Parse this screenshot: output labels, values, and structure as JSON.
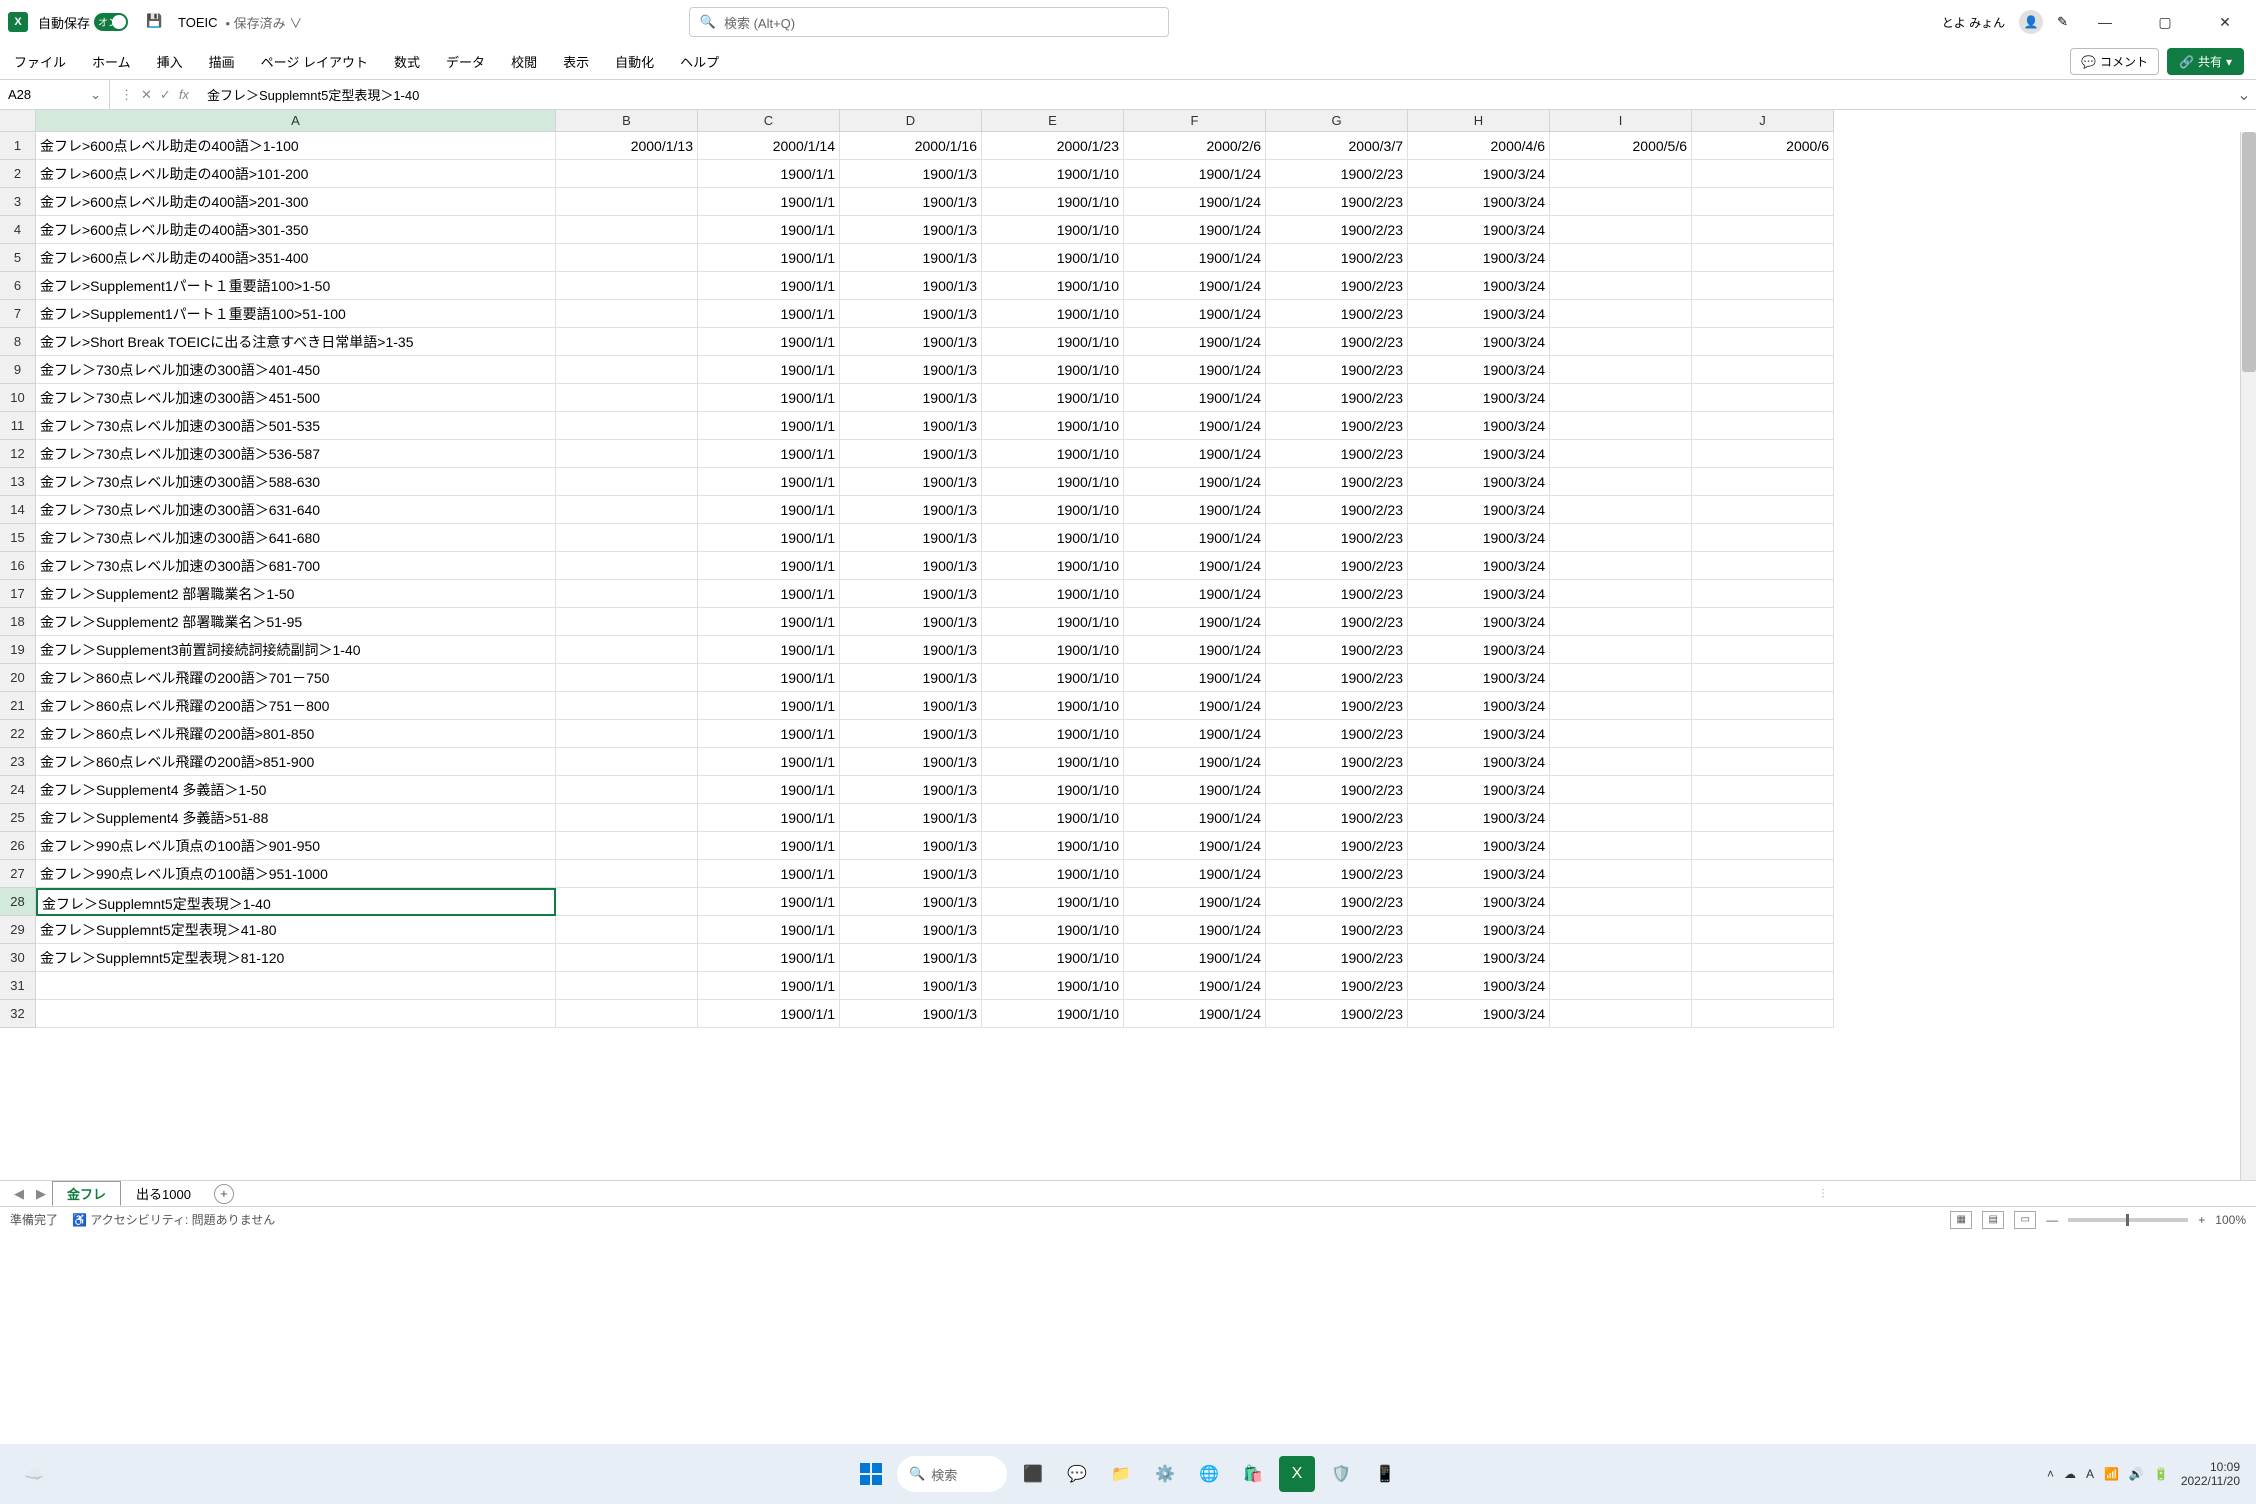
{
  "titlebar": {
    "autosave_label": "自動保存",
    "toggle_text": "オン",
    "doc_name": "TOEIC",
    "saved_status": "• 保存済み ∨",
    "search_placeholder": "検索 (Alt+Q)",
    "user_name": "とよ みょん"
  },
  "ribbon": {
    "tabs": [
      "ファイル",
      "ホーム",
      "挿入",
      "描画",
      "ページ レイアウト",
      "数式",
      "データ",
      "校閲",
      "表示",
      "自動化",
      "ヘルプ"
    ],
    "comment": "コメント",
    "share": "共有"
  },
  "formula": {
    "name_box": "A28",
    "value": "金フレ＞Supplemnt5定型表現＞1-40"
  },
  "columns": [
    "A",
    "B",
    "C",
    "D",
    "E",
    "F",
    "G",
    "H",
    "I",
    "J"
  ],
  "selected_row": 28,
  "rows": [
    {
      "n": 1,
      "A": "金フレ>600点レベル助走の400語＞1-100",
      "B": "2000/1/13",
      "C": "2000/1/14",
      "D": "2000/1/16",
      "E": "2000/1/23",
      "F": "2000/2/6",
      "G": "2000/3/7",
      "H": "2000/4/6",
      "I": "2000/5/6",
      "J": "2000/6"
    },
    {
      "n": 2,
      "A": "金フレ>600点レベル助走の400語>101-200",
      "B": "",
      "C": "1900/1/1",
      "D": "1900/1/3",
      "E": "1900/1/10",
      "F": "1900/1/24",
      "G": "1900/2/23",
      "H": "1900/3/24",
      "I": "",
      "J": ""
    },
    {
      "n": 3,
      "A": "金フレ>600点レベル助走の400語>201-300",
      "B": "",
      "C": "1900/1/1",
      "D": "1900/1/3",
      "E": "1900/1/10",
      "F": "1900/1/24",
      "G": "1900/2/23",
      "H": "1900/3/24",
      "I": "",
      "J": ""
    },
    {
      "n": 4,
      "A": "金フレ>600点レベル助走の400語>301-350",
      "B": "",
      "C": "1900/1/1",
      "D": "1900/1/3",
      "E": "1900/1/10",
      "F": "1900/1/24",
      "G": "1900/2/23",
      "H": "1900/3/24",
      "I": "",
      "J": ""
    },
    {
      "n": 5,
      "A": "金フレ>600点レベル助走の400語>351-400",
      "B": "",
      "C": "1900/1/1",
      "D": "1900/1/3",
      "E": "1900/1/10",
      "F": "1900/1/24",
      "G": "1900/2/23",
      "H": "1900/3/24",
      "I": "",
      "J": ""
    },
    {
      "n": 6,
      "A": "金フレ>Supplement1パート１重要語100>1-50",
      "B": "",
      "C": "1900/1/1",
      "D": "1900/1/3",
      "E": "1900/1/10",
      "F": "1900/1/24",
      "G": "1900/2/23",
      "H": "1900/3/24",
      "I": "",
      "J": ""
    },
    {
      "n": 7,
      "A": "金フレ>Supplement1パート１重要語100>51-100",
      "B": "",
      "C": "1900/1/1",
      "D": "1900/1/3",
      "E": "1900/1/10",
      "F": "1900/1/24",
      "G": "1900/2/23",
      "H": "1900/3/24",
      "I": "",
      "J": ""
    },
    {
      "n": 8,
      "A": "金フレ>Short Break TOEICに出る注意すべき日常単語>1-35",
      "B": "",
      "C": "1900/1/1",
      "D": "1900/1/3",
      "E": "1900/1/10",
      "F": "1900/1/24",
      "G": "1900/2/23",
      "H": "1900/3/24",
      "I": "",
      "J": ""
    },
    {
      "n": 9,
      "A": "金フレ＞730点レベル加速の300語＞401-450",
      "B": "",
      "C": "1900/1/1",
      "D": "1900/1/3",
      "E": "1900/1/10",
      "F": "1900/1/24",
      "G": "1900/2/23",
      "H": "1900/3/24",
      "I": "",
      "J": ""
    },
    {
      "n": 10,
      "A": "金フレ＞730点レベル加速の300語＞451-500",
      "B": "",
      "C": "1900/1/1",
      "D": "1900/1/3",
      "E": "1900/1/10",
      "F": "1900/1/24",
      "G": "1900/2/23",
      "H": "1900/3/24",
      "I": "",
      "J": ""
    },
    {
      "n": 11,
      "A": "金フレ＞730点レベル加速の300語＞501-535",
      "B": "",
      "C": "1900/1/1",
      "D": "1900/1/3",
      "E": "1900/1/10",
      "F": "1900/1/24",
      "G": "1900/2/23",
      "H": "1900/3/24",
      "I": "",
      "J": ""
    },
    {
      "n": 12,
      "A": "金フレ＞730点レベル加速の300語＞536-587",
      "B": "",
      "C": "1900/1/1",
      "D": "1900/1/3",
      "E": "1900/1/10",
      "F": "1900/1/24",
      "G": "1900/2/23",
      "H": "1900/3/24",
      "I": "",
      "J": ""
    },
    {
      "n": 13,
      "A": "金フレ＞730点レベル加速の300語＞588-630",
      "B": "",
      "C": "1900/1/1",
      "D": "1900/1/3",
      "E": "1900/1/10",
      "F": "1900/1/24",
      "G": "1900/2/23",
      "H": "1900/3/24",
      "I": "",
      "J": ""
    },
    {
      "n": 14,
      "A": "金フレ＞730点レベル加速の300語＞631-640",
      "B": "",
      "C": "1900/1/1",
      "D": "1900/1/3",
      "E": "1900/1/10",
      "F": "1900/1/24",
      "G": "1900/2/23",
      "H": "1900/3/24",
      "I": "",
      "J": ""
    },
    {
      "n": 15,
      "A": "金フレ＞730点レベル加速の300語＞641-680",
      "B": "",
      "C": "1900/1/1",
      "D": "1900/1/3",
      "E": "1900/1/10",
      "F": "1900/1/24",
      "G": "1900/2/23",
      "H": "1900/3/24",
      "I": "",
      "J": ""
    },
    {
      "n": 16,
      "A": "金フレ＞730点レベル加速の300語＞681-700",
      "B": "",
      "C": "1900/1/1",
      "D": "1900/1/3",
      "E": "1900/1/10",
      "F": "1900/1/24",
      "G": "1900/2/23",
      "H": "1900/3/24",
      "I": "",
      "J": ""
    },
    {
      "n": 17,
      "A": "金フレ＞Supplement2 部署職業名＞1-50",
      "B": "",
      "C": "1900/1/1",
      "D": "1900/1/3",
      "E": "1900/1/10",
      "F": "1900/1/24",
      "G": "1900/2/23",
      "H": "1900/3/24",
      "I": "",
      "J": ""
    },
    {
      "n": 18,
      "A": "金フレ＞Supplement2 部署職業名＞51-95",
      "B": "",
      "C": "1900/1/1",
      "D": "1900/1/3",
      "E": "1900/1/10",
      "F": "1900/1/24",
      "G": "1900/2/23",
      "H": "1900/3/24",
      "I": "",
      "J": ""
    },
    {
      "n": 19,
      "A": "金フレ＞Supplement3前置詞接続詞接続副詞＞1-40",
      "B": "",
      "C": "1900/1/1",
      "D": "1900/1/3",
      "E": "1900/1/10",
      "F": "1900/1/24",
      "G": "1900/2/23",
      "H": "1900/3/24",
      "I": "",
      "J": ""
    },
    {
      "n": 20,
      "A": "金フレ＞860点レベル飛躍の200語＞701－750",
      "B": "",
      "C": "1900/1/1",
      "D": "1900/1/3",
      "E": "1900/1/10",
      "F": "1900/1/24",
      "G": "1900/2/23",
      "H": "1900/3/24",
      "I": "",
      "J": ""
    },
    {
      "n": 21,
      "A": "金フレ＞860点レベル飛躍の200語＞751－800",
      "B": "",
      "C": "1900/1/1",
      "D": "1900/1/3",
      "E": "1900/1/10",
      "F": "1900/1/24",
      "G": "1900/2/23",
      "H": "1900/3/24",
      "I": "",
      "J": ""
    },
    {
      "n": 22,
      "A": "金フレ＞860点レベル飛躍の200語>801-850",
      "B": "",
      "C": "1900/1/1",
      "D": "1900/1/3",
      "E": "1900/1/10",
      "F": "1900/1/24",
      "G": "1900/2/23",
      "H": "1900/3/24",
      "I": "",
      "J": ""
    },
    {
      "n": 23,
      "A": "金フレ＞860点レベル飛躍の200語>851-900",
      "B": "",
      "C": "1900/1/1",
      "D": "1900/1/3",
      "E": "1900/1/10",
      "F": "1900/1/24",
      "G": "1900/2/23",
      "H": "1900/3/24",
      "I": "",
      "J": ""
    },
    {
      "n": 24,
      "A": "金フレ＞Supplement4 多義語＞1-50",
      "B": "",
      "C": "1900/1/1",
      "D": "1900/1/3",
      "E": "1900/1/10",
      "F": "1900/1/24",
      "G": "1900/2/23",
      "H": "1900/3/24",
      "I": "",
      "J": ""
    },
    {
      "n": 25,
      "A": "金フレ＞Supplement4 多義語>51-88",
      "B": "",
      "C": "1900/1/1",
      "D": "1900/1/3",
      "E": "1900/1/10",
      "F": "1900/1/24",
      "G": "1900/2/23",
      "H": "1900/3/24",
      "I": "",
      "J": ""
    },
    {
      "n": 26,
      "A": "金フレ＞990点レベル頂点の100語＞901-950",
      "B": "",
      "C": "1900/1/1",
      "D": "1900/1/3",
      "E": "1900/1/10",
      "F": "1900/1/24",
      "G": "1900/2/23",
      "H": "1900/3/24",
      "I": "",
      "J": ""
    },
    {
      "n": 27,
      "A": "金フレ＞990点レベル頂点の100語＞951-1000",
      "B": "",
      "C": "1900/1/1",
      "D": "1900/1/3",
      "E": "1900/1/10",
      "F": "1900/1/24",
      "G": "1900/2/23",
      "H": "1900/3/24",
      "I": "",
      "J": ""
    },
    {
      "n": 28,
      "A": "金フレ＞Supplemnt5定型表現＞1-40",
      "B": "",
      "C": "1900/1/1",
      "D": "1900/1/3",
      "E": "1900/1/10",
      "F": "1900/1/24",
      "G": "1900/2/23",
      "H": "1900/3/24",
      "I": "",
      "J": ""
    },
    {
      "n": 29,
      "A": "金フレ＞Supplemnt5定型表現＞41-80",
      "B": "",
      "C": "1900/1/1",
      "D": "1900/1/3",
      "E": "1900/1/10",
      "F": "1900/1/24",
      "G": "1900/2/23",
      "H": "1900/3/24",
      "I": "",
      "J": ""
    },
    {
      "n": 30,
      "A": "金フレ＞Supplemnt5定型表現＞81-120",
      "B": "",
      "C": "1900/1/1",
      "D": "1900/1/3",
      "E": "1900/1/10",
      "F": "1900/1/24",
      "G": "1900/2/23",
      "H": "1900/3/24",
      "I": "",
      "J": ""
    },
    {
      "n": 31,
      "A": "",
      "B": "",
      "C": "1900/1/1",
      "D": "1900/1/3",
      "E": "1900/1/10",
      "F": "1900/1/24",
      "G": "1900/2/23",
      "H": "1900/3/24",
      "I": "",
      "J": ""
    },
    {
      "n": 32,
      "A": "",
      "B": "",
      "C": "1900/1/1",
      "D": "1900/1/3",
      "E": "1900/1/10",
      "F": "1900/1/24",
      "G": "1900/2/23",
      "H": "1900/3/24",
      "I": "",
      "J": ""
    }
  ],
  "sheets": {
    "active": "金フレ",
    "others": [
      "出る1000"
    ]
  },
  "status": {
    "ready": "準備完了",
    "accessibility": "アクセシビリティ: 問題ありません",
    "zoom": "100%"
  },
  "taskbar": {
    "search": "検索",
    "time": "10:09",
    "date": "2022/11/20"
  }
}
